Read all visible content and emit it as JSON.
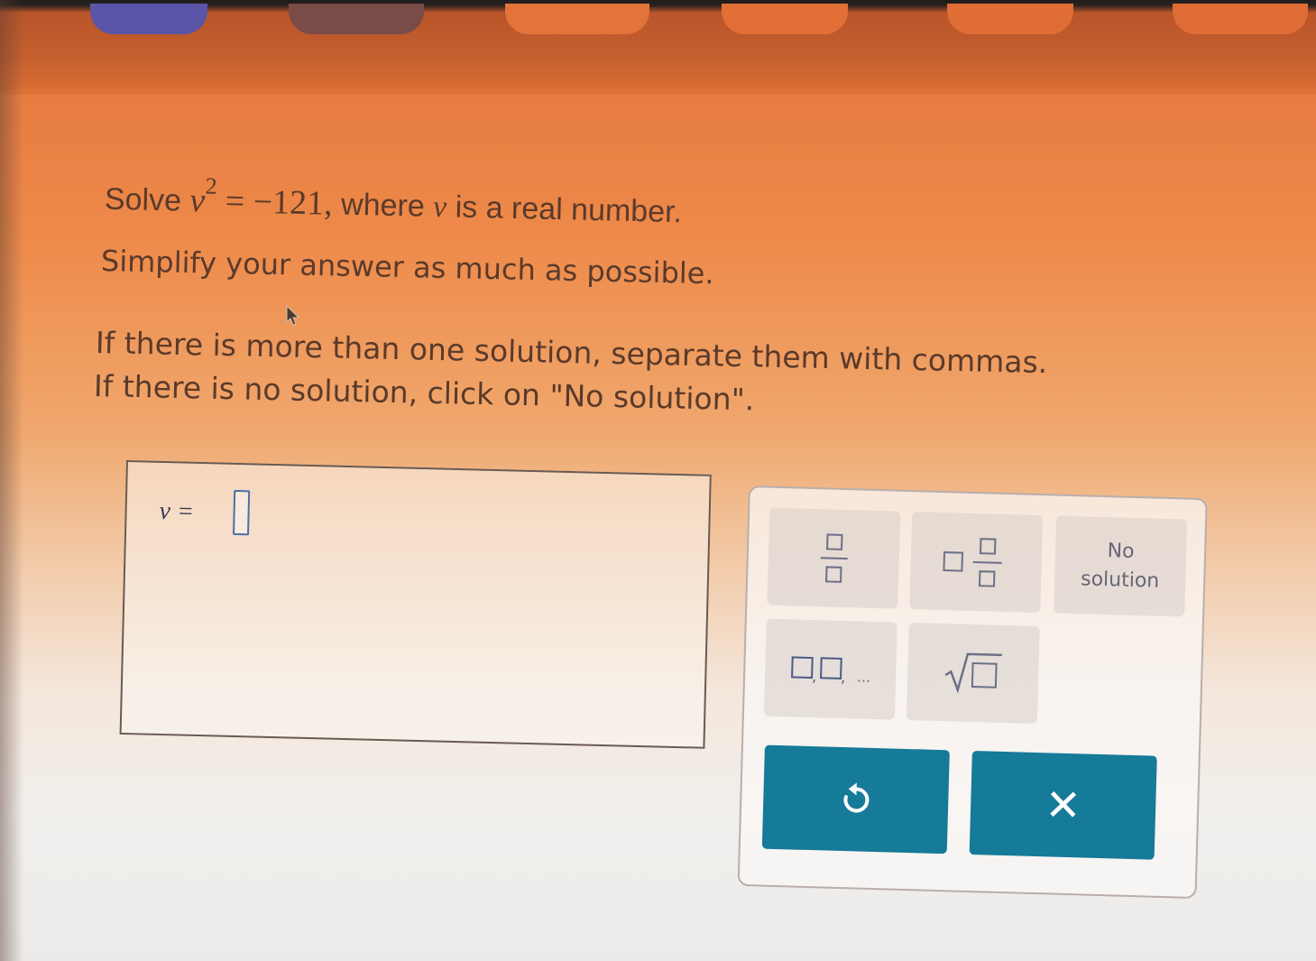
{
  "question": {
    "solve_word": "Solve",
    "variable": "v",
    "exponent": "2",
    "rhs": "= −121,",
    "condition_prefix": "where",
    "condition_var": "v",
    "condition_suffix": "is a real number.",
    "line2": "Simplify your answer as much as possible.",
    "line3": "If there is more than one solution, separate them with commas.",
    "line4": "If there is no solution, click on \"No solution\"."
  },
  "answer": {
    "label": "v =",
    "value": ""
  },
  "keypad": {
    "no_solution_label": "No\nsolution",
    "list_ellipsis": "...",
    "clear_glyph": "✕"
  },
  "colors": {
    "accent_button": "#167a99",
    "input_border": "#4b6fa8"
  },
  "icons": {
    "fraction": "fraction-icon",
    "mixed_number": "mixed-number-icon",
    "list": "list-icon",
    "square_root": "square-root-icon",
    "undo": "undo-icon",
    "clear": "clear-icon",
    "cursor": "mouse-cursor-icon"
  }
}
